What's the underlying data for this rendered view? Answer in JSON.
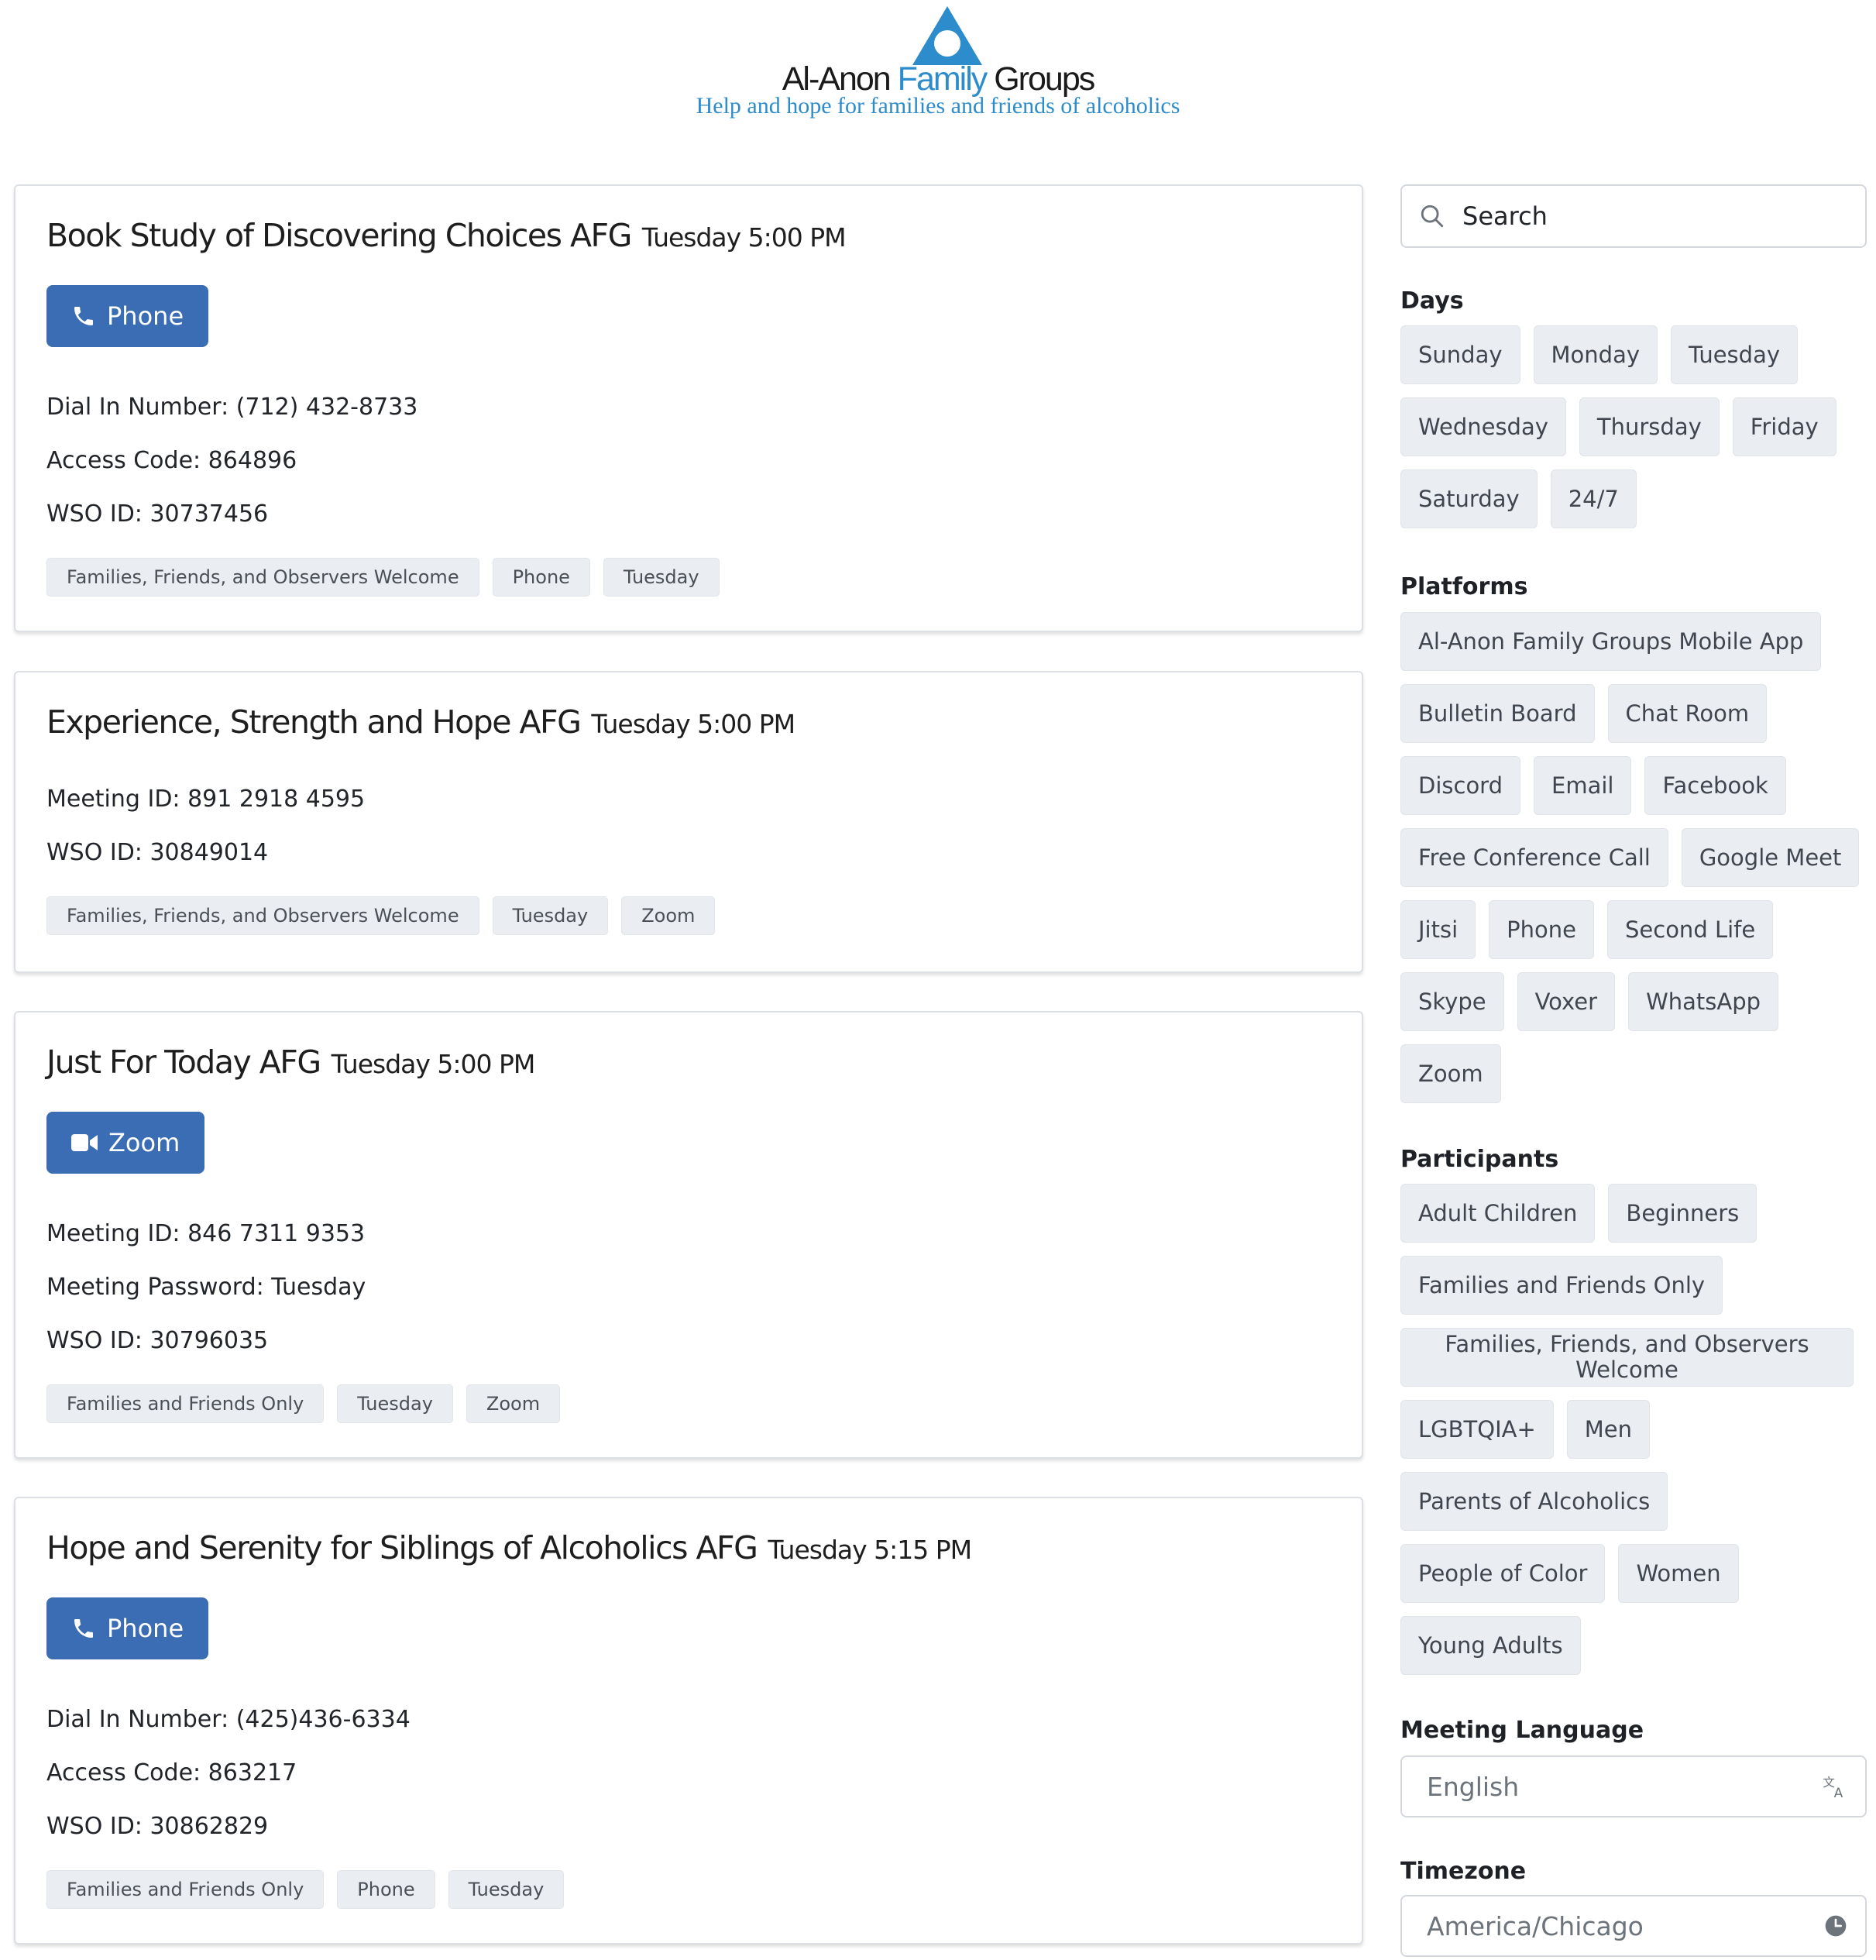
{
  "header": {
    "logo_brand_1": "Al-Anon ",
    "logo_brand_2": "Family",
    "logo_brand_3": " Groups",
    "tagline": "Help and hope for families and friends of alcoholics"
  },
  "meetings": [
    {
      "name": "Book Study of Discovering Choices AFG",
      "time": "Tuesday 5:00 PM",
      "button": "Phone",
      "details": [
        "Dial In Number: (712) 432-8733",
        "Access Code: 864896",
        "WSO ID: 30737456"
      ],
      "tags": [
        "Families, Friends, and Observers Welcome",
        "Phone",
        "Tuesday"
      ]
    },
    {
      "name": "Experience, Strength and Hope AFG",
      "time": "Tuesday 5:00 PM",
      "details": [
        "Meeting ID: 891 2918 4595",
        "WSO ID: 30849014"
      ],
      "tags": [
        "Families, Friends, and Observers Welcome",
        "Tuesday",
        "Zoom"
      ]
    },
    {
      "name": "Just For Today AFG",
      "time": "Tuesday 5:00 PM",
      "button": "Zoom",
      "details": [
        "Meeting ID: 846 7311 9353",
        "Meeting Password: Tuesday",
        "WSO ID: 30796035"
      ],
      "tags": [
        "Families and Friends Only",
        "Tuesday",
        "Zoom"
      ]
    },
    {
      "name": "Hope and Serenity for Siblings of Alcoholics AFG",
      "time": "Tuesday 5:15 PM",
      "button": "Phone",
      "details": [
        "Dial In Number: (425)436-6334",
        "Access Code: 863217",
        "WSO ID: 30862829"
      ],
      "tags": [
        "Families and Friends Only",
        "Phone",
        "Tuesday"
      ]
    }
  ],
  "sidebar": {
    "search_placeholder": "Search",
    "days_title": "Days",
    "days": [
      "Sunday",
      "Monday",
      "Tuesday",
      "Wednesday",
      "Thursday",
      "Friday",
      "Saturday",
      "24/7"
    ],
    "platforms_title": "Platforms",
    "platforms": [
      "Al-Anon Family Groups Mobile App",
      "Bulletin Board",
      "Chat Room",
      "Discord",
      "Email",
      "Facebook",
      "Free Conference Call",
      "Google Meet",
      "Jitsi",
      "Phone",
      "Second Life",
      "Skype",
      "Voxer",
      "WhatsApp",
      "Zoom"
    ],
    "participants_title": "Participants",
    "participants": [
      "Adult Children",
      "Beginners",
      "Families and Friends Only",
      "Families, Friends, and Observers Welcome",
      "LGBTQIA+",
      "Men",
      "Parents of Alcoholics",
      "People of Color",
      "Women",
      "Young Adults"
    ],
    "language_title": "Meeting Language",
    "language_value": "English",
    "timezone_title": "Timezone",
    "timezone_value": "America/Chicago"
  },
  "colors": {
    "primary": "#3a6db3",
    "logo_blue": "#2d8ccb",
    "chip_bg": "#eaedf1"
  },
  "icons": {
    "phone": "phone-icon",
    "zoom": "video-camera-icon",
    "search": "search-icon",
    "language": "translate-icon",
    "timezone": "clock-icon"
  }
}
